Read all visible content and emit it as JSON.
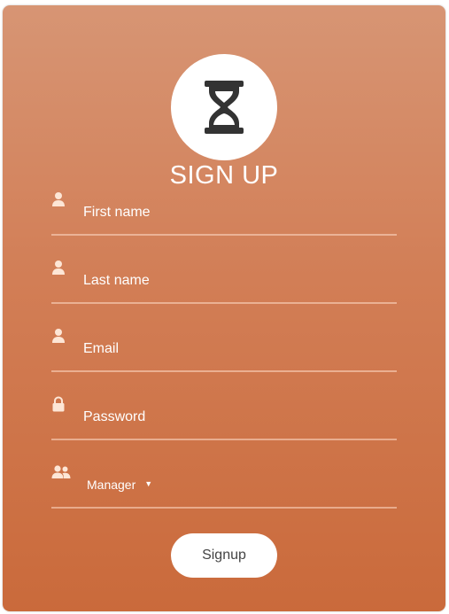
{
  "form": {
    "title": "SIGN UP",
    "logo_icon": "hourglass-icon",
    "fields": [
      {
        "name": "first-name",
        "icon": "user-icon",
        "placeholder": "First name",
        "value": ""
      },
      {
        "name": "last-name",
        "icon": "user-icon",
        "placeholder": "Last name",
        "value": ""
      },
      {
        "name": "email",
        "icon": "user-icon",
        "placeholder": "Email",
        "value": ""
      },
      {
        "name": "password",
        "icon": "lock-icon",
        "placeholder": "Password",
        "value": ""
      }
    ],
    "role": {
      "icon": "users-icon",
      "selected": "Manager"
    },
    "submit_label": "Signup"
  },
  "colors": {
    "gradient_top": "#d79574",
    "gradient_bottom": "#ca6a3b",
    "icon_fill": "#fde6d6",
    "logo_icon_fill": "#333333"
  }
}
